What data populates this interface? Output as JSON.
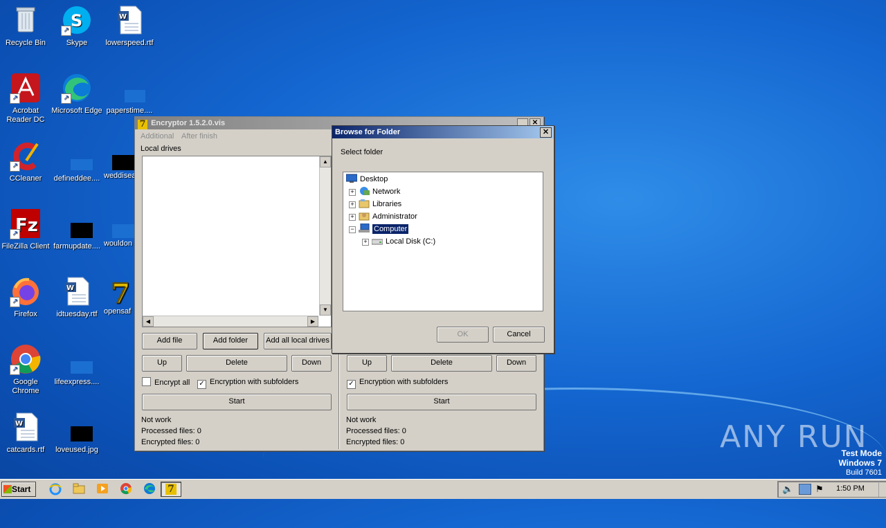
{
  "desktop": {
    "icons": [
      {
        "label": "Recycle Bin"
      },
      {
        "label": "Skype"
      },
      {
        "label": "lowerspeed.rtf"
      },
      {
        "label": "Acrobat Reader DC"
      },
      {
        "label": "Microsoft Edge"
      },
      {
        "label": "paperstime...."
      },
      {
        "label": "CCleaner"
      },
      {
        "label": "defineddee...."
      },
      {
        "label": "weddisea"
      },
      {
        "label": "FileZilla Client"
      },
      {
        "label": "farmupdate...."
      },
      {
        "label": "wouldon"
      },
      {
        "label": "Firefox"
      },
      {
        "label": "idtuesday.rtf"
      },
      {
        "label": "opensaf"
      },
      {
        "label": "Google Chrome"
      },
      {
        "label": "lifeexpress...."
      },
      {
        "label": "catcards.rtf"
      },
      {
        "label": "loveused.jpg"
      }
    ]
  },
  "encryptor": {
    "title": "Encryptor 1.5.2.0.vis",
    "menu": [
      "Additional",
      "After finish"
    ],
    "group_label": "Local drives",
    "buttons": {
      "add_file": "Add file",
      "add_folder": "Add folder",
      "add_all": "Add all local drives",
      "up": "Up",
      "delete": "Delete",
      "down": "Down",
      "start": "Start"
    },
    "checks": {
      "encrypt_all": "Encrypt all",
      "subfolders": "Encryption with subfolders"
    },
    "status": {
      "state": "Not work",
      "processed": "Processed files: 0",
      "encrypted": "Encrypted files: 0"
    }
  },
  "dialog": {
    "title": "Browse for Folder",
    "prompt": "Select folder",
    "tree": [
      "Desktop",
      "Network",
      "Libraries",
      "Administrator",
      "Computer",
      "Local Disk (C:)"
    ],
    "ok": "OK",
    "cancel": "Cancel"
  },
  "watermark": {
    "brand": "ANY RUN",
    "mode": "Test Mode",
    "os": "Windows 7",
    "build": "Build 7601"
  },
  "taskbar": {
    "start": "Start",
    "clock": "1:50 PM"
  },
  "colors": {
    "titlebar_active": "#0a246a",
    "titlebar_inactive": "#808080",
    "selection": "#0a246a"
  }
}
